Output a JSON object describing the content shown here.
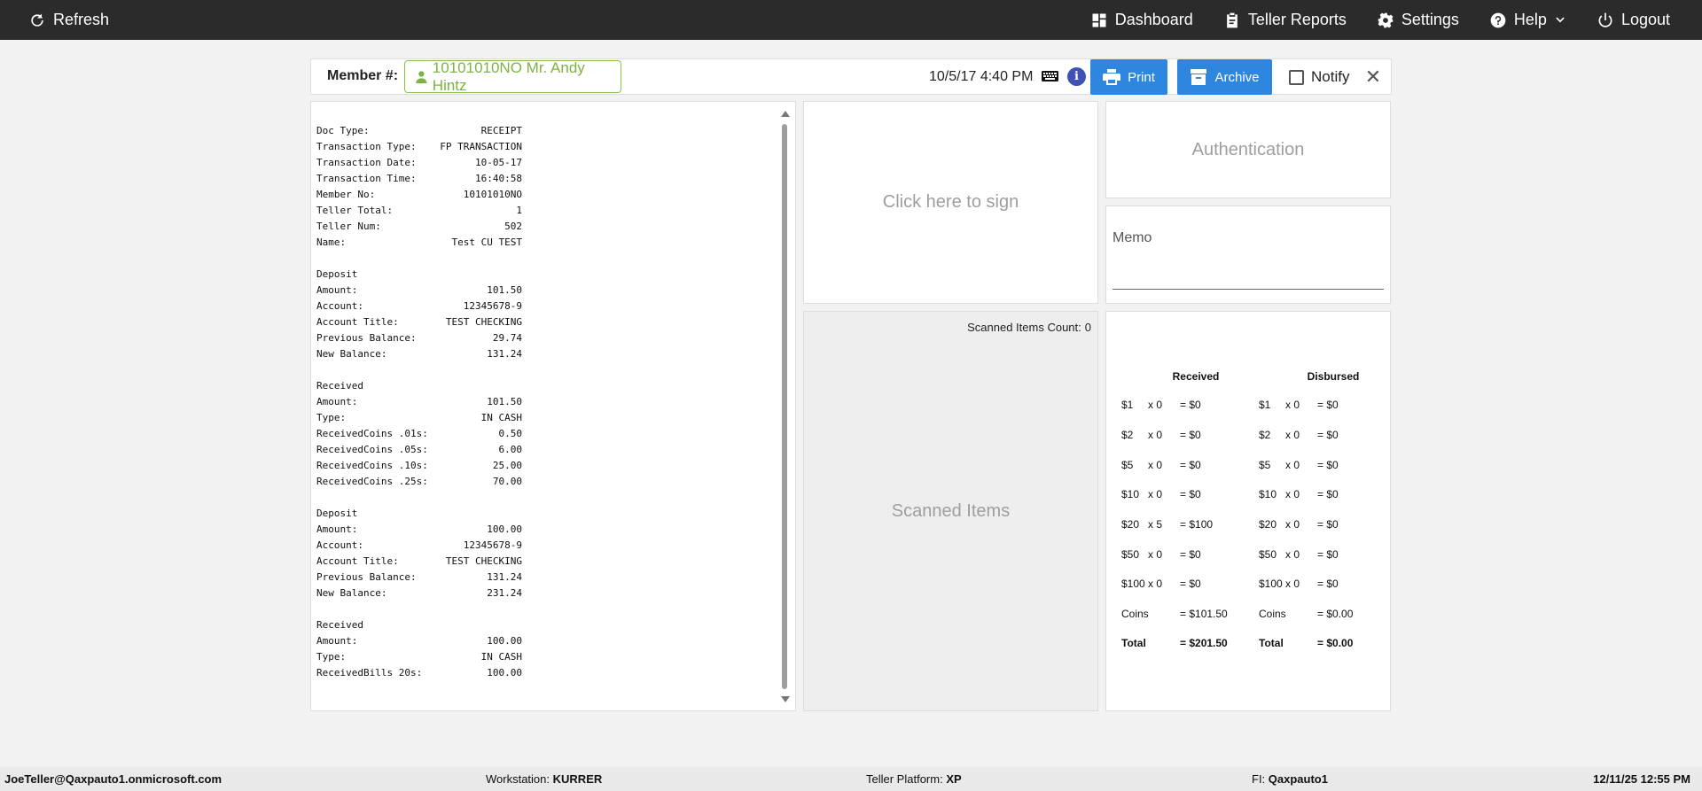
{
  "nav": {
    "refresh": "Refresh",
    "dashboard": "Dashboard",
    "teller_reports": "Teller Reports",
    "settings": "Settings",
    "help": "Help",
    "logout": "Logout"
  },
  "member_bar": {
    "label": "Member #:",
    "member_value": "10101010NO Mr. Andy Hintz",
    "datetime": "10/5/17 4:40 PM",
    "print_label": "Print",
    "archive_label": "Archive",
    "notify_label": "Notify",
    "notify_checked": false
  },
  "receipt": {
    "lines": [
      [
        "Doc Type:",
        "RECEIPT"
      ],
      [
        "Transaction Type:",
        "FP TRANSACTION"
      ],
      [
        "Transaction Date:",
        "10-05-17"
      ],
      [
        "Transaction Time:",
        "16:40:58"
      ],
      [
        "Member No:",
        "10101010NO"
      ],
      [
        "Teller Total:",
        "1"
      ],
      [
        "Teller Num:",
        "502"
      ],
      [
        "Name:",
        "Test CU TEST"
      ],
      null,
      [
        "Deposit",
        ""
      ],
      [
        "Amount:",
        "101.50"
      ],
      [
        "Account:",
        "12345678-9"
      ],
      [
        "Account Title:",
        "TEST CHECKING"
      ],
      [
        "Previous Balance:",
        "29.74"
      ],
      [
        "New Balance:",
        "131.24"
      ],
      null,
      [
        "Received",
        ""
      ],
      [
        "Amount:",
        "101.50"
      ],
      [
        "Type:",
        "IN CASH"
      ],
      [
        "ReceivedCoins .01s:",
        "0.50"
      ],
      [
        "ReceivedCoins .05s:",
        "6.00"
      ],
      [
        "ReceivedCoins .10s:",
        "25.00"
      ],
      [
        "ReceivedCoins .25s:",
        "70.00"
      ],
      null,
      [
        "Deposit",
        ""
      ],
      [
        "Amount:",
        "100.00"
      ],
      [
        "Account:",
        "12345678-9"
      ],
      [
        "Account Title:",
        "TEST CHECKING"
      ],
      [
        "Previous Balance:",
        "131.24"
      ],
      [
        "New Balance:",
        "231.24"
      ],
      null,
      [
        "Received",
        ""
      ],
      [
        "Amount:",
        "100.00"
      ],
      [
        "Type:",
        "IN CASH"
      ],
      [
        "ReceivedBills 20s:",
        "100.00"
      ]
    ]
  },
  "sign_panel": {
    "prompt": "Click here to sign"
  },
  "scanned_panel": {
    "count_label": "Scanned Items Count:",
    "count": "0",
    "title": "Scanned Items"
  },
  "auth_panel": {
    "title": "Authentication"
  },
  "memo_panel": {
    "label": "Memo"
  },
  "cash": {
    "received_header": "Received",
    "disbursed_header": "Disbursed",
    "received": [
      [
        "$1",
        "x 0",
        "= $0"
      ],
      [
        "$2",
        "x 0",
        "= $0"
      ],
      [
        "$5",
        "x 0",
        "= $0"
      ],
      [
        "$10",
        "x 0",
        "= $0"
      ],
      [
        "$20",
        "x 5",
        "= $100"
      ],
      [
        "$50",
        "x 0",
        "= $0"
      ],
      [
        "$100",
        "x 0",
        "= $0"
      ],
      [
        "Coins",
        "",
        "= $101.50"
      ],
      [
        "Total",
        "",
        "= $201.50"
      ]
    ],
    "disbursed": [
      [
        "$1",
        "x 0",
        "= $0"
      ],
      [
        "$2",
        "x 0",
        "= $0"
      ],
      [
        "$5",
        "x 0",
        "= $0"
      ],
      [
        "$10",
        "x 0",
        "= $0"
      ],
      [
        "$20",
        "x 0",
        "= $0"
      ],
      [
        "$50",
        "x 0",
        "= $0"
      ],
      [
        "$100",
        "x 0",
        "= $0"
      ],
      [
        "Coins",
        "",
        "= $0.00"
      ],
      [
        "Total",
        "",
        "= $0.00"
      ]
    ]
  },
  "footer": {
    "user": "JoeTeller@Qaxpauto1.onmicrosoft.com",
    "workstation_label": "Workstation:",
    "workstation": "KURRER",
    "platform_label": "Teller Platform:",
    "platform": "XP",
    "fi_label": "FI:",
    "fi": "Qaxpauto1",
    "datetime": "12/11/25 12:55 PM"
  },
  "colors": {
    "topbar": "#2b2b2b",
    "button_blue": "#2e86de",
    "member_green": "#7cb342",
    "info_blue": "#3f51b5"
  }
}
